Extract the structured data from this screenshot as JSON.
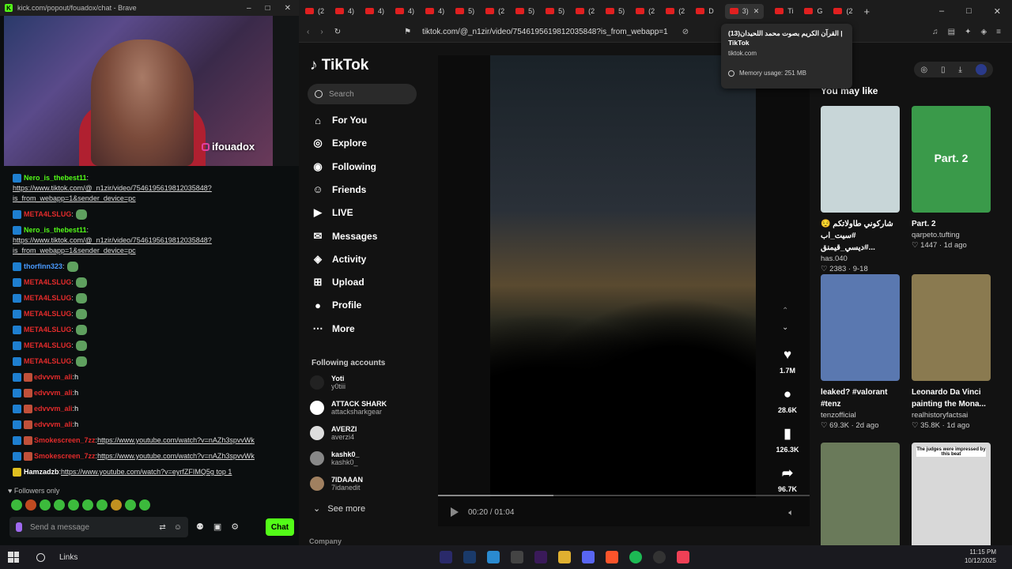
{
  "kick": {
    "window_title": "kick.com/popout/fouadox/chat - Brave",
    "stream_caption": "ifouadox",
    "messages": [
      {
        "user": "Nero_is_thebest11",
        "color": "green",
        "text": "https://www.tiktok.com/@_n1zir/video/7546195619812035848?is_from_webapp=1&sender_device=pc"
      },
      {
        "user": "META4LSLUG",
        "color": "red",
        "text": ""
      },
      {
        "user": "Nero_is_thebest11",
        "color": "green",
        "text": "https://www.tiktok.com/@_n1zir/video/7546195619812035848?is_from_webapp=1&sender_device=pc"
      },
      {
        "user": "thorfinn323",
        "color": "blue",
        "text": ""
      },
      {
        "user": "META4LSLUG",
        "color": "red",
        "text": ""
      },
      {
        "user": "META4LSLUG",
        "color": "red",
        "text": ""
      },
      {
        "user": "META4LSLUG",
        "color": "red",
        "text": ""
      },
      {
        "user": "META4LSLUG",
        "color": "red",
        "text": ""
      },
      {
        "user": "META4LSLUG",
        "color": "red",
        "text": ""
      },
      {
        "user": "META4LSLUG",
        "color": "red",
        "text": ""
      },
      {
        "user": "edvvvm_ali",
        "color": "red",
        "text": "h"
      },
      {
        "user": "edvvvm_ali",
        "color": "red",
        "text": "h"
      },
      {
        "user": "edvvvm_ali",
        "color": "red",
        "text": "h"
      },
      {
        "user": "edvvvm_ali",
        "color": "red",
        "text": "h"
      },
      {
        "user": "Smokescreen_7zz",
        "color": "red",
        "text": "https://www.youtube.com/watch?v=nAZh3spvvWk"
      },
      {
        "user": "Smokescreen_7zz",
        "color": "red",
        "text": "https://www.youtube.com/watch?v=nAZh3spvvWk"
      },
      {
        "user": "Hamzadzb",
        "color": "white",
        "text": "https://www.youtube.com/watch?v=eyrfZFIMQ5g top 1"
      }
    ],
    "followers_only": "Followers only",
    "input_placeholder": "Send a message",
    "chat_button": "Chat"
  },
  "browser": {
    "tabs": [
      "(2",
      "4)",
      "4)",
      "4)",
      "4)",
      "5)",
      "(2",
      "5)",
      "5)",
      "(2",
      "5)",
      "(2",
      "(2",
      "D",
      "3)",
      "Ti",
      "G",
      "(2"
    ],
    "url": "tiktok.com/@_n1zir/video/7546195619812035848?is_from_webapp=1"
  },
  "tooltip": {
    "title": "(13)القرآن الكريم بصوت محمد اللحيدان | TikTok",
    "domain": "tiktok.com",
    "memory": "Memory usage: 251 MB"
  },
  "tiktok": {
    "logo": "TikTok",
    "search_placeholder": "Search",
    "nav": [
      "For You",
      "Explore",
      "Following",
      "Friends",
      "LIVE",
      "Messages",
      "Activity",
      "Upload",
      "Profile",
      "More"
    ],
    "following_accounts_title": "Following accounts",
    "accounts": [
      {
        "name": "Yoti",
        "handle": "y0tiii"
      },
      {
        "name": "ATTACK SHARK",
        "handle": "attacksharkgear"
      },
      {
        "name": "AVERZI",
        "handle": "averzi4"
      },
      {
        "name": "kashk0_",
        "handle": "kashk0_"
      },
      {
        "name": "7IDAAAN",
        "handle": "7idanedit"
      }
    ],
    "see_more": "See more",
    "company": "Company",
    "video": {
      "time": "00:20 / 01:04",
      "progress": 0.31,
      "likes": "1.7M",
      "comments": "28.6K",
      "saves": "126.3K",
      "shares": "96.7K"
    },
    "you_may_like": "You may like",
    "cards": [
      {
        "caption": "شاركوني طاولاتكم 😌 #سيت_اب #ديسي_قيمنق...",
        "author": "has.040",
        "stats": "♡ 2383 · 9-18",
        "color": "#c8d6d8"
      },
      {
        "caption": "Part. 2",
        "author": "qarpeto.tufting",
        "stats": "♡ 1447 · 1d ago",
        "color": "#3a9a4a",
        "overlay": "Part. 2"
      },
      {
        "caption": "leaked? #valorant #tenz",
        "author": "tenzofficial",
        "stats": "♡ 69.3K · 2d ago",
        "color": "#5a78b0"
      },
      {
        "caption": "Leonardo Da Vinci painting the Mona...",
        "author": "realhistoryfactsai",
        "stats": "♡ 35.8K · 1d ago",
        "color": "#8a7a50"
      },
      {
        "caption": "",
        "author": "",
        "stats": "",
        "color": "#6a7a5a"
      },
      {
        "caption": "",
        "author": "",
        "stats": "",
        "color": "#d8d8d8",
        "overlay": "The judges were impressed by this beat"
      }
    ]
  },
  "taskbar": {
    "search": "Links",
    "time": "11:15 PM",
    "date": "10/12/2025"
  }
}
